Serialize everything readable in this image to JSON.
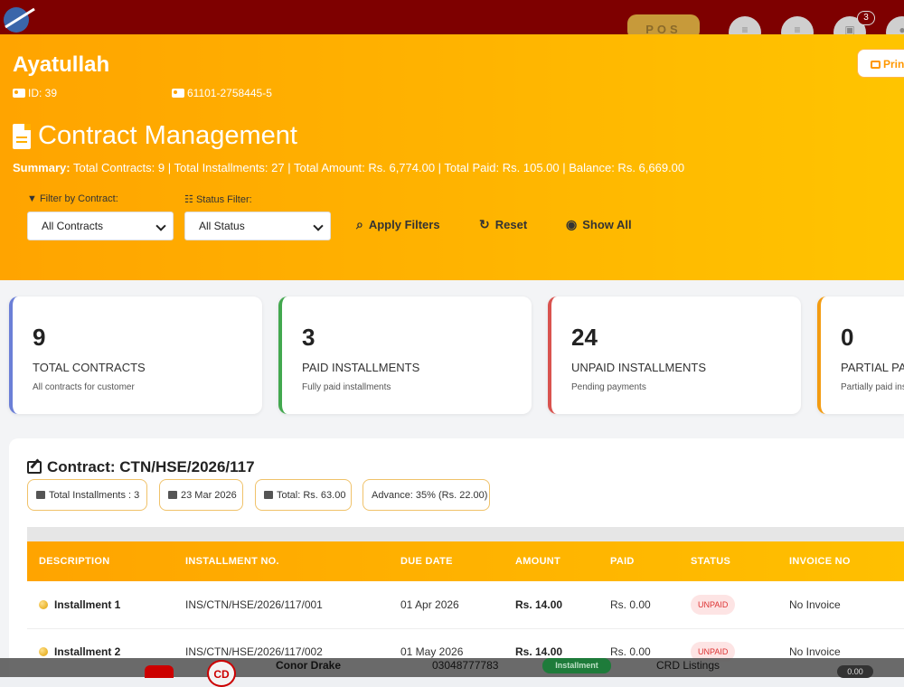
{
  "app": {
    "pos_label": "POS",
    "notif_count": "3"
  },
  "customer": {
    "name": "Ayatullah",
    "id_text": "ID: 39",
    "cnic": "61101-2758445-5"
  },
  "print_label": "Print",
  "page_title": "Contract Management",
  "summary": {
    "label": "Summary:",
    "text": "Total Contracts: 9 | Total Installments: 27 | Total Amount: Rs. 6,774.00 | Total Paid: Rs. 105.00 | Balance: Rs. 6,669.00"
  },
  "filters": {
    "contract_label": "Filter by Contract:",
    "contract_value": "All Contracts",
    "status_label": "Status Filter:",
    "status_value": "All Status",
    "apply": "Apply Filters",
    "reset": "Reset",
    "show_all": "Show All"
  },
  "stats": [
    {
      "value": "9",
      "label": "TOTAL CONTRACTS",
      "sub": "All contracts for customer",
      "color": "#6b7fd7"
    },
    {
      "value": "3",
      "label": "PAID INSTALLMENTS",
      "sub": "Fully paid installments",
      "color": "#43a84f"
    },
    {
      "value": "24",
      "label": "UNPAID INSTALLMENTS",
      "sub": "Pending payments",
      "color": "#d9534f"
    },
    {
      "value": "0",
      "label": "PARTIAL PAY",
      "sub": "Partially paid ins",
      "color": "#f39c12"
    }
  ],
  "contract": {
    "title": "Contract: CTN/HSE/2026/117",
    "chips": {
      "installments": "Total Installments : 3",
      "date": "23 Mar 2026",
      "total": "Total: Rs. 63.00",
      "advance": "Advance: 35% (Rs. 22.00)"
    },
    "columns": [
      "DESCRIPTION",
      "INSTALLMENT NO.",
      "DUE DATE",
      "AMOUNT",
      "PAID",
      "STATUS",
      "INVOICE NO"
    ],
    "rows": [
      {
        "description": "Installment 1",
        "no": "INS/CTN/HSE/2026/117/001",
        "due": "01 Apr 2026",
        "amount": "Rs. 14.00",
        "paid": "Rs. 0.00",
        "status": "UNPAID",
        "invoice": "No Invoice"
      },
      {
        "description": "Installment 2",
        "no": "INS/CTN/HSE/2026/117/002",
        "due": "01 May 2026",
        "amount": "Rs. 14.00",
        "paid": "Rs. 0.00",
        "status": "UNPAID",
        "invoice": "No Invoice"
      }
    ]
  },
  "background_row": {
    "initials": "CD",
    "name": "Conor Drake",
    "phone": "03048777783",
    "type": "Installment",
    "listing": "CRD Listings",
    "amount": "0.00"
  }
}
